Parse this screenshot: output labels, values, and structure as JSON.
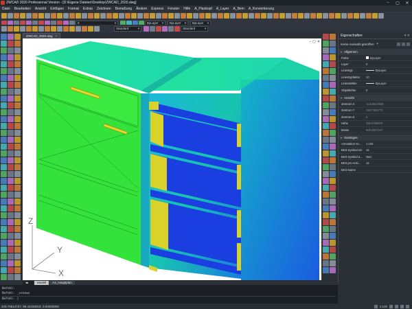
{
  "app": {
    "title": "ZWCAD 2020 Professional Version - [D:\\Eigene Dateien\\Desktop\\ZWCAD_2020.dwg]",
    "window_buttons": [
      "–",
      "▢",
      "✕"
    ]
  },
  "menu": [
    "Datei",
    "Bearbeiten",
    "Ansicht",
    "Einfügen",
    "Format",
    "Extras",
    "Zeichnen",
    "Bemaßung",
    "Ändern",
    "Express",
    "Fenster",
    "Hilfe",
    "A_Plankopf",
    "A_Layer",
    "A_Bem",
    "A_Konvertierung"
  ],
  "toolbar": {
    "layer_combo": "0",
    "color_combo": "ByLayer",
    "linetype_combo": "ByLayer",
    "lineweight_combo": "ByLayer",
    "style_combo": "Standard",
    "text_style_combo": "Standard"
  },
  "document": {
    "tab_label": "ZWCAD_2020.dwg",
    "close_glyph": "×",
    "viewport_buttons": [
      "–",
      "▢",
      "✕"
    ]
  },
  "model_tabs": [
    "Modell",
    "A4_Hauptplan"
  ],
  "axes": {
    "x": "X",
    "y": "Y",
    "z": "Z"
  },
  "properties": {
    "title": "Eigenschaften",
    "controls": "▾ ✕",
    "selection": "Keine Auswahl getroffen",
    "sections": [
      {
        "name": "Allgemein",
        "rows": [
          {
            "key": "Farbe",
            "value": "ByLayer",
            "swatch": true
          },
          {
            "key": "Layer",
            "value": "0"
          },
          {
            "key": "Linientyp",
            "value": "ByLayer",
            "line": true
          },
          {
            "key": "Linientypfaktor",
            "value": "10"
          },
          {
            "key": "Linienstärke",
            "value": "ByLayer",
            "line": true
          },
          {
            "key": "Objekthöhe",
            "value": "0"
          }
        ]
      },
      {
        "name": "Ansicht",
        "rows": [
          {
            "key": "Zentrum X",
            "value": "-118.6617836",
            "dim": true
          },
          {
            "key": "Zentrum Y",
            "value": "150.7192773",
            "dim": true
          },
          {
            "key": "Zentrum Z",
            "value": "0",
            "dim": true
          },
          {
            "key": "Höhe",
            "value": "392.6766879",
            "dim": true
          },
          {
            "key": "Breite",
            "value": "600.0847247",
            "dim": true
          }
        ]
      },
      {
        "name": "Sonstiges",
        "rows": [
          {
            "key": "Annotation Sc...",
            "value": "1:100"
          },
          {
            "key": "BKS-Symbol ein",
            "value": "Ja"
          },
          {
            "key": "BKS-Symbol a...",
            "value": "Nein"
          },
          {
            "key": "BKS pro Ansi...",
            "value": "Ja"
          },
          {
            "key": "BKS-Name",
            "value": ""
          }
        ]
      }
    ]
  },
  "command": {
    "lines": [
      "Befehl:",
      "Befehl: _vsnews"
    ],
    "prompt": "Befehl: |"
  },
  "status": {
    "coords": "429.79614737, 98.44150018, 0.00000000",
    "scale": "1:100"
  },
  "colors": {
    "front_green": "#33e23a",
    "top_teal": "#1ee0a6",
    "shelf_blue": "#1a3ee0",
    "side_yellow": "#d8d22a",
    "accent_cyan": "#18b8c8"
  }
}
